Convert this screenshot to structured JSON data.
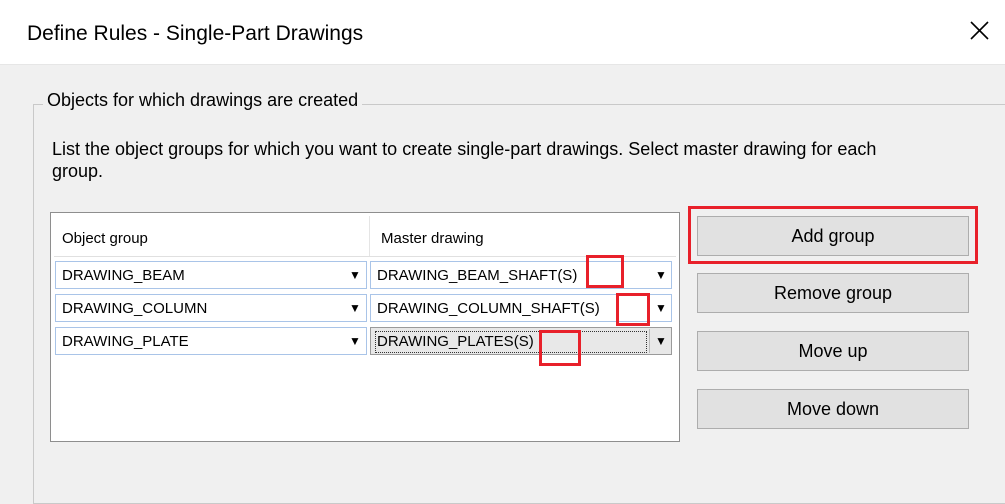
{
  "window": {
    "title": "Define Rules - Single-Part Drawings",
    "close_glyph": "✕"
  },
  "group_box": {
    "legend": "Objects for which drawings are created",
    "description": "List the object groups for which you want to create single-part drawings. Select master drawing for each group."
  },
  "grid": {
    "columns": [
      "Object group",
      "Master drawing"
    ],
    "rows": [
      {
        "object_group": "DRAWING_BEAM",
        "master_drawing": "DRAWING_BEAM_SHAFT",
        "suffix": "(S)"
      },
      {
        "object_group": "DRAWING_COLUMN",
        "master_drawing": "DRAWING_COLUMN_SHAFT",
        "suffix": "(S)"
      },
      {
        "object_group": "DRAWING_PLATE",
        "master_drawing": "DRAWING_PLATES",
        "suffix": "(S)"
      }
    ],
    "dropdown_glyph": "▼"
  },
  "buttons": {
    "add_group": "Add group",
    "remove_group": "Remove group",
    "move_up": "Move up",
    "move_down": "Move down"
  },
  "colors": {
    "highlight": "#e8202a",
    "dialog_bg": "#f0f0f0"
  }
}
